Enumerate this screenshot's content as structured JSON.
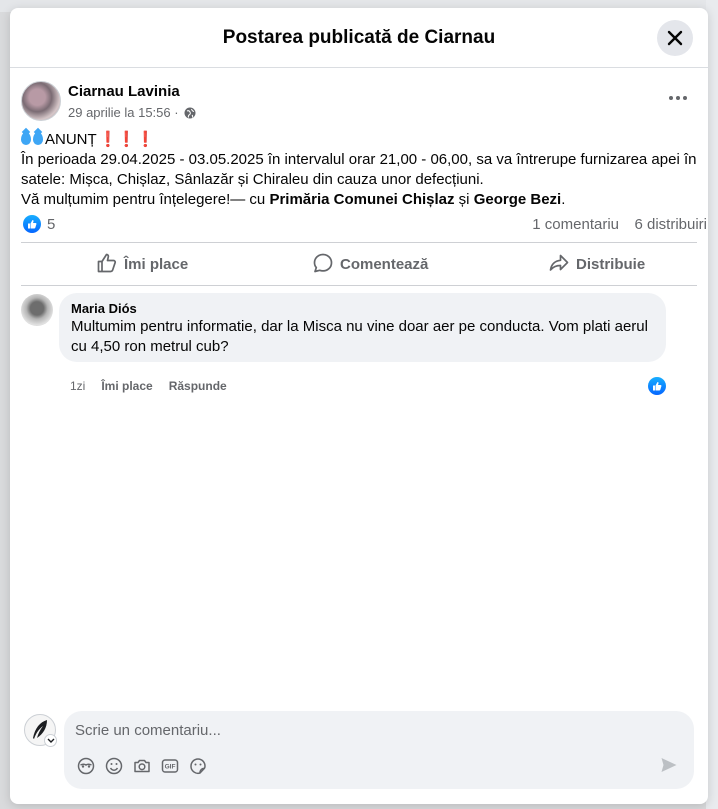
{
  "modal": {
    "title": "Postarea publicată de Ciarnau"
  },
  "post": {
    "author": "Ciarnau Lavinia",
    "date": "29 aprilie la 15:56",
    "separator": " · ",
    "heading_text": "ANUNȚ",
    "heading_marks": "❗❗❗",
    "line1": "În perioada 29.04.2025 - 03.05.2025 în intervalul orar 21,00 - 06,00, sa va întrerupe furnizarea apei în satele: Mișca, Chișlaz, Sânlazăr și Chiraleu din cauza unor defecțiuni.",
    "line2_prefix": "Vă mulțumim pentru înțelegere!— cu ",
    "tag1": "Primăria Comunei Chișlaz",
    "conj": " și ",
    "tag2": "George Bezi",
    "period": "."
  },
  "reactions": {
    "count": "5",
    "comments": "1 comentariu",
    "shares": "6 distribuiri"
  },
  "actions": {
    "like": "Îmi place",
    "comment": "Comentează",
    "share": "Distribuie"
  },
  "comment": {
    "name": "Maria Diós",
    "text": "Multumim pentru informatie, dar la Misca nu vine doar aer pe conducta. Vom plati aerul cu 4,50 ron metrul cub?",
    "age": "1zi",
    "like": "Îmi place",
    "reply": "Răspunde"
  },
  "composer": {
    "placeholder": "Scrie un comentariu..."
  },
  "colors": {
    "accent": "#0866ff",
    "muted": "#65676b",
    "bubble": "#f0f2f5"
  },
  "icons": [
    "close-icon",
    "globe-icon",
    "more-icon",
    "like-icon",
    "comment-icon",
    "share-icon",
    "avatar-chooser-icon",
    "emoji-icon",
    "camera-icon",
    "gif-icon",
    "sticker-icon",
    "send-icon"
  ]
}
